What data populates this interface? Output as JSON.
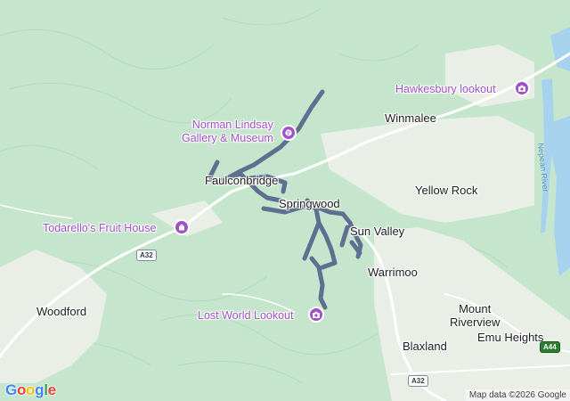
{
  "map": {
    "places": {
      "winmalee": "Winmalee",
      "faulconbridge": "Faulconbridge",
      "springwood": "Springwood",
      "yellow_rock": "Yellow Rock",
      "sun_valley": "Sun Valley",
      "warrimoo": "Warrimoo",
      "woodford": "Woodford",
      "mount_riverview": "Mount\nRiverview",
      "blaxland": "Blaxland",
      "emu_heights": "Emu Heights"
    },
    "pois": {
      "hawkesbury_lookout": "Hawkesbury lookout",
      "norman_lindsay": "Norman Lindsay\nGallery & Museum",
      "todarellos": "Todarello's Fruit House",
      "lost_world": "Lost World Lookout"
    },
    "river": "Nepean River",
    "roads": {
      "a32_west": "A32",
      "a32_south": "A32",
      "a44": "A44"
    },
    "attribution": "Map data ©2026 Google",
    "logo": "Google",
    "colors": {
      "route": "#5f6f8f",
      "poi": "#a052c8",
      "water": "#a6d2ee",
      "forest": "#bfe3c8",
      "urban": "#eef1ec",
      "road": "#ffffff"
    }
  }
}
